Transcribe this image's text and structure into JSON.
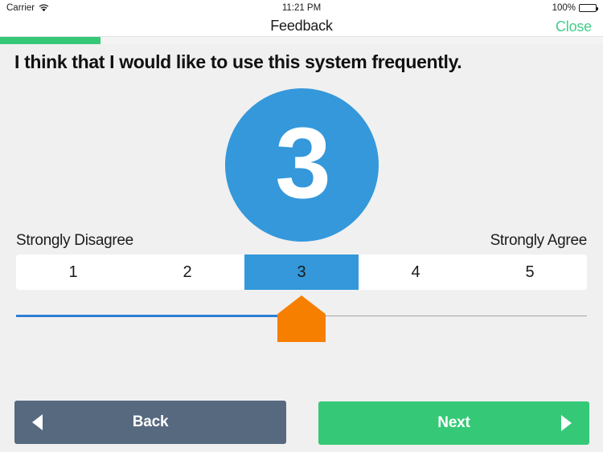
{
  "status_bar": {
    "carrier": "Carrier",
    "wifi_icon": "wifi-icon",
    "time": "11:21 PM",
    "battery_percent": "100%",
    "battery_icon": "battery-full-icon"
  },
  "nav_bar": {
    "title": "Feedback",
    "close_label": "Close"
  },
  "progress": {
    "percent": 16.7
  },
  "survey": {
    "question": "I think that I would like to use this system frequently.",
    "selected_value": "3",
    "anchor_low": "Strongly Disagree",
    "anchor_high": "Strongly Agree",
    "scale": [
      {
        "label": "1",
        "selected": false
      },
      {
        "label": "2",
        "selected": false
      },
      {
        "label": "3",
        "selected": true
      },
      {
        "label": "4",
        "selected": false
      },
      {
        "label": "5",
        "selected": false
      }
    ],
    "slider": {
      "min": 1,
      "max": 5,
      "value": 3,
      "fill_percent": 50
    }
  },
  "footer": {
    "back_label": "Back",
    "next_label": "Next",
    "back_icon": "arrow-left-icon",
    "next_icon": "arrow-right-icon"
  },
  "colors": {
    "accent_blue": "#3498db",
    "accent_green": "#35c977",
    "thumb_orange": "#f77f00",
    "back_gray": "#56697f",
    "page_background": "#f0f0f0"
  }
}
